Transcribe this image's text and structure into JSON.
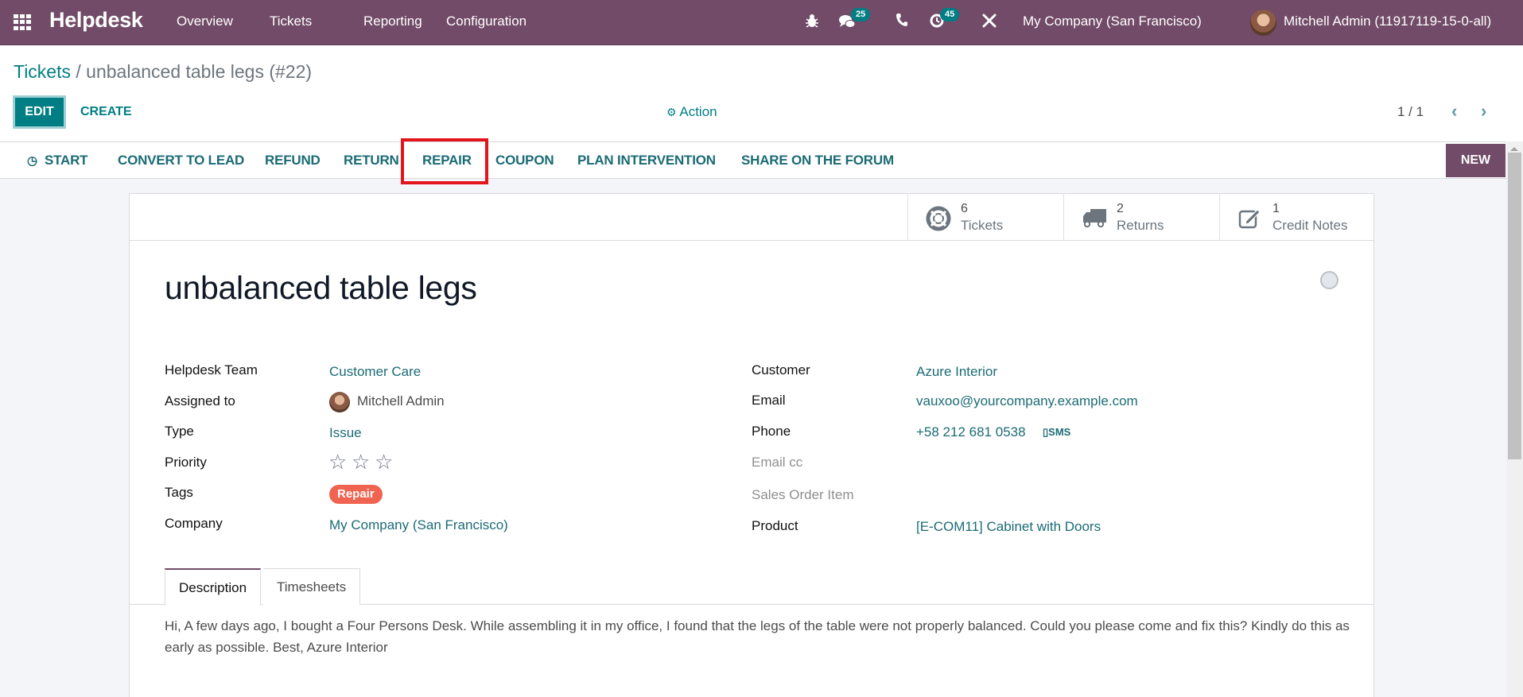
{
  "navbar": {
    "app_name": "Helpdesk",
    "menu": [
      "Overview",
      "Tickets",
      "Reporting",
      "Configuration"
    ],
    "icons": [
      "bug-icon",
      "chat-icon",
      "phone-icon",
      "activity-clock-icon",
      "tools-icon"
    ],
    "messages_count": "25",
    "activities_count": "45",
    "company": "My Company (San Francisco)",
    "user": "Mitchell Admin (11917119-15-0-all)"
  },
  "breadcrumb": {
    "parent": "Tickets",
    "separator": " / ",
    "current": "unbalanced table legs (#22)"
  },
  "toolbar": {
    "edit_label": "EDIT",
    "create_label": "CREATE",
    "action_label": "Action",
    "pager": "1 / 1"
  },
  "statusbar": {
    "buttons": [
      "START",
      "CONVERT TO LEAD",
      "REFUND",
      "RETURN",
      "REPAIR",
      "COUPON",
      "PLAN INTERVENTION",
      "SHARE ON THE FORUM"
    ],
    "highlighted": "REPAIR",
    "stage": "NEW"
  },
  "stat_buttons": [
    {
      "icon": "lifebuoy-icon",
      "value": "6",
      "label": "Tickets"
    },
    {
      "icon": "truck-icon",
      "value": "2",
      "label": "Returns"
    },
    {
      "icon": "edit-note-icon",
      "value": "1",
      "label": "Credit Notes"
    }
  ],
  "ticket": {
    "title": "unbalanced table legs",
    "left_fields": [
      {
        "label": "Helpdesk Team",
        "value": "Customer Care"
      },
      {
        "label": "Assigned to",
        "value": "Mitchell Admin"
      },
      {
        "label": "Type",
        "value": "Issue"
      },
      {
        "label": "Priority",
        "value": "0 of 3 stars"
      },
      {
        "label": "Tags",
        "value": "Repair"
      },
      {
        "label": "Company",
        "value": "My Company (San Francisco)"
      }
    ],
    "right_fields": [
      {
        "label": "Customer",
        "value": "Azure Interior"
      },
      {
        "label": "Email",
        "value": "vauxoo@yourcompany.example.com"
      },
      {
        "label": "Phone",
        "value": "+58 212 681 0538"
      },
      {
        "label": "Email cc",
        "value": ""
      },
      {
        "label": "Sales Order Item",
        "value": ""
      },
      {
        "label": "Product",
        "value": "[E-COM11] Cabinet with Doors"
      }
    ],
    "sms_label": "SMS",
    "priority_stars": 0,
    "tag_color": "#ef6350"
  },
  "tabs": [
    "Description",
    "Timesheets"
  ],
  "active_tab": "Description",
  "description": "Hi, A few days ago, I bought a Four Persons Desk. While assembling it in my office, I found that the legs of the table were not properly balanced. Could you please come and fix this? Kindly do this as early as possible. Best, Azure Interior",
  "colors": {
    "brand": "#714b67",
    "accent": "#017e84",
    "highlight_box": "#e3151c"
  }
}
